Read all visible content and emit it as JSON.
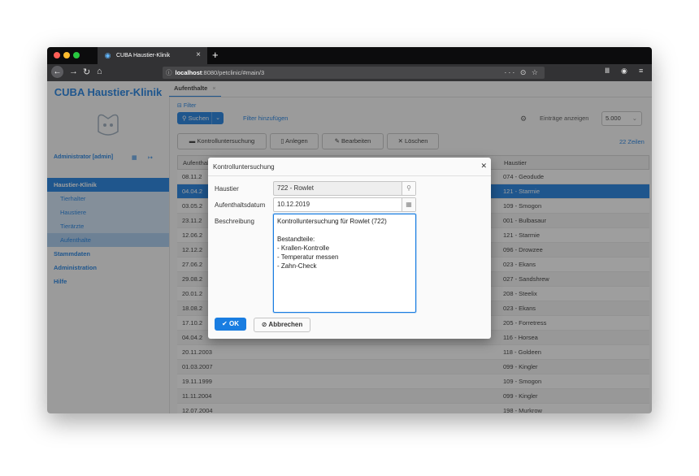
{
  "browser": {
    "tab_title": "CUBA Haustier-Klinik",
    "url_host": "localhost",
    "url_rest": ":8080/petclinic/#main/3",
    "url_right_icons": "··· ⊙ ☆"
  },
  "sidebar": {
    "app_name": "CUBA Haustier-Klinik",
    "user": "Administrator [admin]",
    "menu": [
      {
        "label": "Haustier-Klinik"
      },
      {
        "label": "Tierhalter"
      },
      {
        "label": "Haustiere"
      },
      {
        "label": "Tierärzte"
      },
      {
        "label": "Aufenthalte"
      },
      {
        "label": "Stammdaten"
      },
      {
        "label": "Administration"
      },
      {
        "label": "Hilfe"
      }
    ]
  },
  "main": {
    "tab_label": "Aufenthalte",
    "filter_label": "Filter",
    "search_label": "Suchen",
    "add_filter": "Filter hinzufügen",
    "show_rows_label": "Einträge anzeigen",
    "rows_value": "5.000",
    "buttons": {
      "kontroll": "Kontrolluntersuchung",
      "create": "Anlegen",
      "edit": "Bearbeiten",
      "delete": "Löschen"
    },
    "row_count": "22 Zeilen",
    "columns": [
      "Aufenthalt",
      "Haustier"
    ],
    "rows": [
      {
        "date": "08.11.2",
        "pet": "074 - Geodude"
      },
      {
        "date": "04.04.2",
        "pet": "121 - Starmie"
      },
      {
        "date": "03.05.2",
        "pet": "109 - Smogon"
      },
      {
        "date": "23.11.2",
        "pet": "001 - Bulbasaur"
      },
      {
        "date": "12.06.2",
        "pet": "121 - Starmie"
      },
      {
        "date": "12.12.2",
        "pet": "096 - Drowzee"
      },
      {
        "date": "27.06.2",
        "pet": "023 - Ekans"
      },
      {
        "date": "29.08.2",
        "pet": "027 - Sandshrew"
      },
      {
        "date": "20.01.2",
        "pet": "208 - Steelix"
      },
      {
        "date": "18.08.2",
        "pet": "023 - Ekans"
      },
      {
        "date": "17.10.2",
        "pet": "205 - Forretress"
      },
      {
        "date": "04.04.2",
        "pet": "116 - Horsea"
      },
      {
        "date": "20.11.2003",
        "pet": "118 - Goldeen"
      },
      {
        "date": "01.03.2007",
        "pet": "099 - Kingler"
      },
      {
        "date": "19.11.1999",
        "pet": "109 - Smogon"
      },
      {
        "date": "11.11.2004",
        "pet": "099 - Kingler"
      },
      {
        "date": "12.07.2004",
        "pet": "198 - Murkrow"
      }
    ]
  },
  "dialog": {
    "title": "Kontrolluntersuchung",
    "pet_label": "Haustier",
    "pet_value": "722 - Rowlet",
    "date_label": "Aufenthaltsdatum",
    "date_value": "10.12.2019",
    "desc_label": "Beschreibung",
    "desc_lines": [
      "Kontrolluntersuchung für Rowlet (722)",
      "",
      "Bestandteile:",
      "- Krallen-Kontrolle",
      "- Temperatur messen",
      "- Zahn-Check"
    ],
    "ok_label": "OK",
    "cancel_label": "Abbrechen"
  }
}
